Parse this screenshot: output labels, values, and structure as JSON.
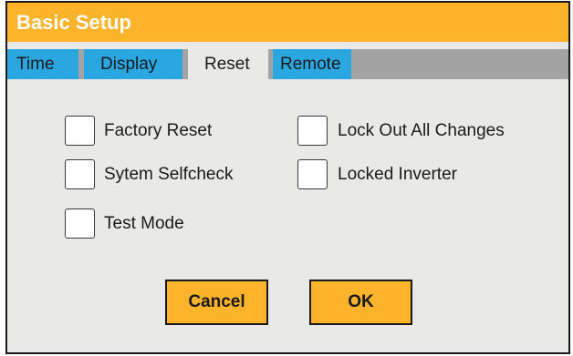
{
  "window": {
    "title": "Basic Setup"
  },
  "tabs": [
    {
      "label": "Time",
      "active": false
    },
    {
      "label": "Display",
      "active": false
    },
    {
      "label": "Reset",
      "active": true
    },
    {
      "label": "Remote",
      "active": false
    }
  ],
  "options": {
    "factory_reset": {
      "label": "Factory Reset",
      "checked": false
    },
    "system_selfcheck": {
      "label": "Sytem Selfcheck",
      "checked": false
    },
    "test_mode": {
      "label": "Test Mode",
      "checked": false
    },
    "lock_out_all_changes": {
      "label": "Lock Out All Changes",
      "checked": false
    },
    "locked_inverter": {
      "label": "Locked Inverter",
      "checked": false
    }
  },
  "buttons": {
    "cancel_label": "Cancel",
    "ok_label": "OK"
  },
  "colors": {
    "title_bar": "#fdb32a",
    "tab_blue": "#2aa7e1",
    "tab_strip": "#a3a3a3",
    "panel": "#e9e9e7",
    "button": "#fdb32a"
  }
}
